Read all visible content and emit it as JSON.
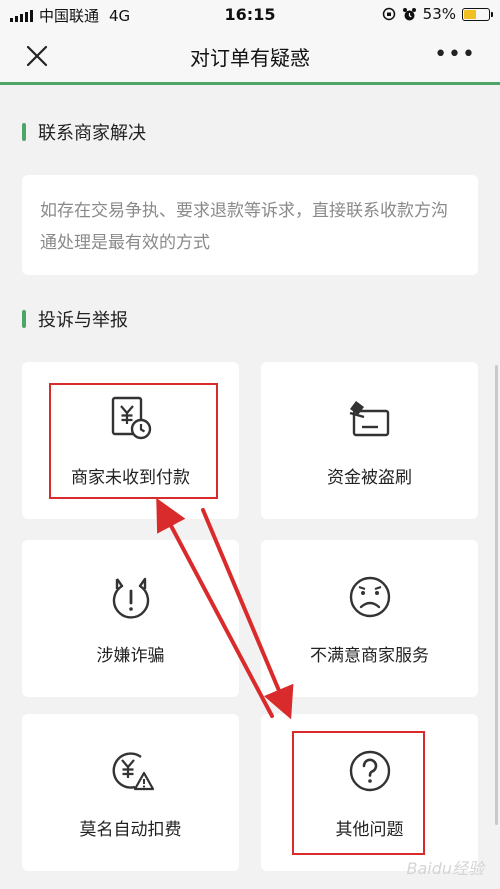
{
  "status_bar": {
    "carrier": "中国联通",
    "network": "4G",
    "time": "16:15",
    "battery": "53%",
    "battery_level": 0.53
  },
  "nav": {
    "title": "对订单有疑惑",
    "more": "•••"
  },
  "contact_section": {
    "title": "联系商家解决",
    "description": "如存在交易争执、要求退款等诉求，直接联系收款方沟通处理是最有效的方式"
  },
  "report_section": {
    "title": "投诉与举报",
    "items": [
      {
        "label": "商家未收到付款",
        "icon": "payment-pending-icon"
      },
      {
        "label": "资金被盗刷",
        "icon": "card-theft-icon"
      },
      {
        "label": "涉嫌诈骗",
        "icon": "fraud-warning-icon"
      },
      {
        "label": "不满意商家服务",
        "icon": "sad-face-icon"
      },
      {
        "label": "莫名自动扣费",
        "icon": "auto-charge-warning-icon"
      },
      {
        "label": "其他问题",
        "icon": "question-icon"
      }
    ]
  },
  "watermark": "Baidu经验",
  "colors": {
    "accent": "#4fa567",
    "annotation": "#d92b2b",
    "background": "#f2f2f2"
  }
}
